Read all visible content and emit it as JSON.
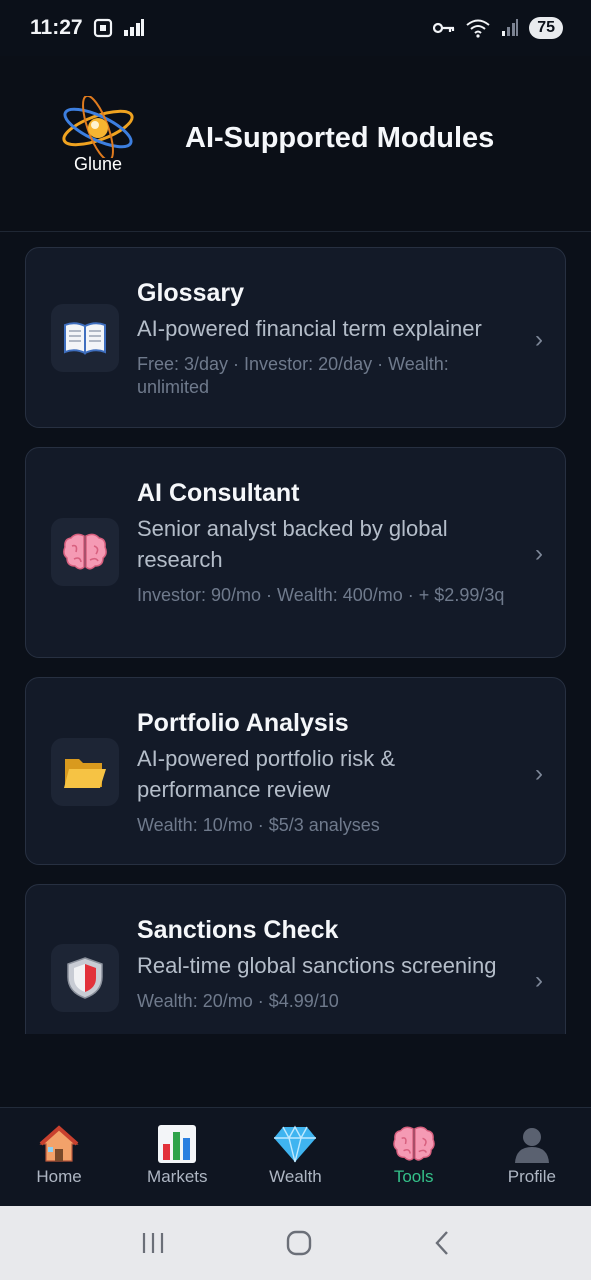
{
  "status_bar": {
    "time": "11:27",
    "battery": "75"
  },
  "header": {
    "logo_text": "Glune",
    "title": "AI-Supported Modules"
  },
  "modules": [
    {
      "title": "Glossary",
      "description": "AI-powered financial term explainer",
      "meta": "Free: 3/day · Investor: 20/day · Wealth: unlimited",
      "icon": "book-icon"
    },
    {
      "title": "AI Consultant",
      "description": "Senior analyst backed by global research",
      "meta": "Investor: 90/mo · Wealth: 400/mo · + $2.99/3q",
      "icon": "brain-icon"
    },
    {
      "title": "Portfolio Analysis",
      "description": "AI-powered portfolio risk & performance review",
      "meta": "Wealth: 10/mo · $5/3 analyses",
      "icon": "folder-icon"
    },
    {
      "title": "Sanctions Check",
      "description": "Real-time global sanctions screening",
      "meta": "Wealth: 20/mo · $4.99/10",
      "icon": "shield-icon"
    }
  ],
  "nav": [
    {
      "label": "Home",
      "icon": "house-icon"
    },
    {
      "label": "Markets",
      "icon": "bar-chart-icon"
    },
    {
      "label": "Wealth",
      "icon": "diamond-icon"
    },
    {
      "label": "Tools",
      "icon": "brain-icon",
      "active": true
    },
    {
      "label": "Profile",
      "icon": "person-icon"
    }
  ],
  "colors": {
    "background": "#0b1019",
    "card": "#131a28",
    "accent": "#34c089"
  }
}
